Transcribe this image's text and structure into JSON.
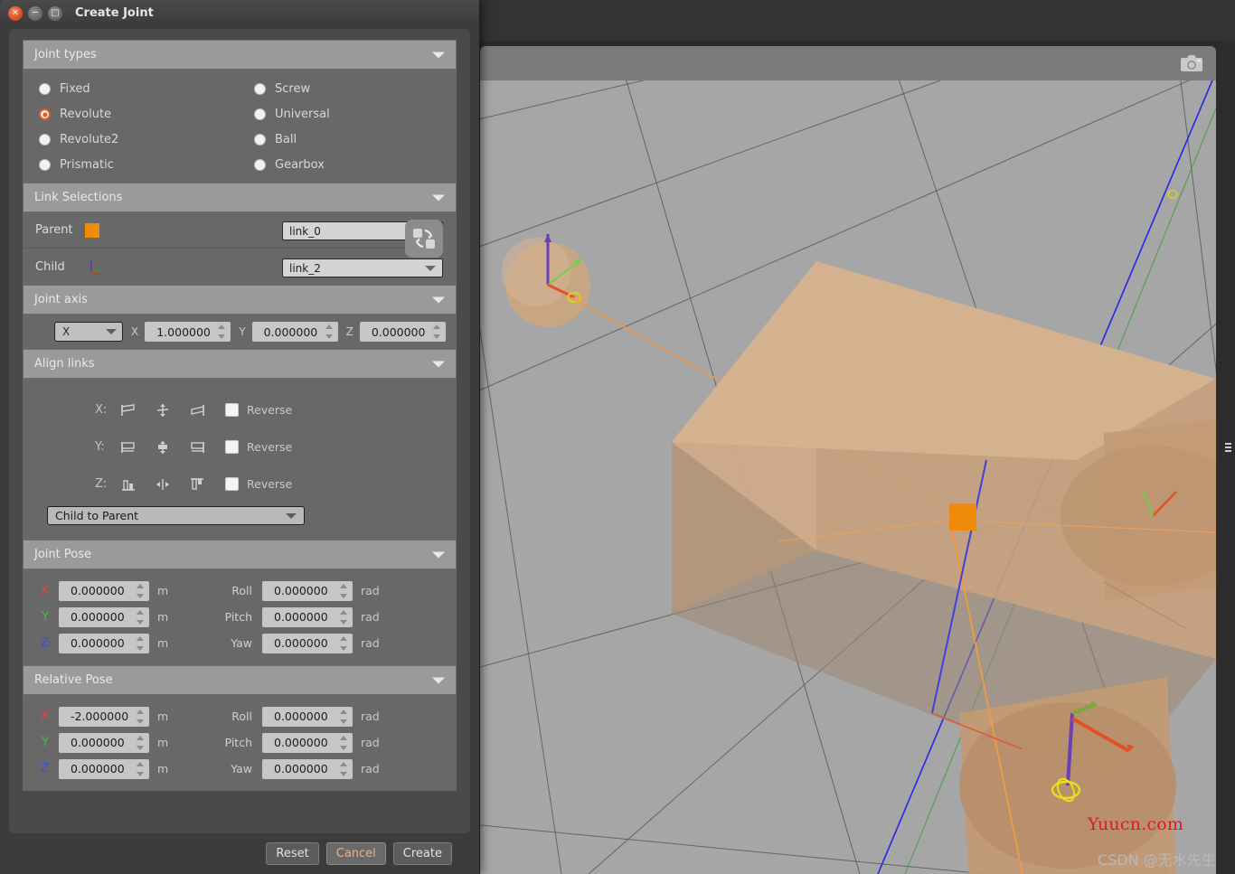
{
  "window": {
    "title": "Create Joint",
    "buttons": {
      "close": "close-button",
      "minimize": "minimize-button",
      "maximize": "maximize-button"
    }
  },
  "groups": {
    "joint_types": {
      "header": "Joint types",
      "options": [
        {
          "label": "Fixed",
          "selected": false
        },
        {
          "label": "Screw",
          "selected": false
        },
        {
          "label": "Revolute",
          "selected": true
        },
        {
          "label": "Universal",
          "selected": false
        },
        {
          "label": "Revolute2",
          "selected": false
        },
        {
          "label": "Ball",
          "selected": false
        },
        {
          "label": "Prismatic",
          "selected": false
        },
        {
          "label": "Gearbox",
          "selected": false
        }
      ]
    },
    "link_selections": {
      "header": "Link Selections",
      "parent_label": "Parent",
      "parent_value": "link_0",
      "child_label": "Child",
      "child_value": "link_2",
      "swap_button": "swap-links-button"
    },
    "joint_axis": {
      "header": "Joint axis",
      "preset": "X",
      "x_label": "X",
      "x_value": "1.000000",
      "y_label": "Y",
      "y_value": "0.000000",
      "z_label": "Z",
      "z_value": "0.000000"
    },
    "align_links": {
      "header": "Align links",
      "rows": [
        {
          "axis": "X:",
          "reverse_label": "Reverse",
          "reverse_checked": false
        },
        {
          "axis": "Y:",
          "reverse_label": "Reverse",
          "reverse_checked": false
        },
        {
          "axis": "Z:",
          "reverse_label": "Reverse",
          "reverse_checked": false
        }
      ],
      "mode": "Child to Parent"
    },
    "joint_pose": {
      "header": "Joint Pose",
      "rows": [
        {
          "axis": "X",
          "value": "0.000000",
          "unit": "m",
          "rot_label": "Roll",
          "rot_value": "0.000000",
          "rot_unit": "rad"
        },
        {
          "axis": "Y",
          "value": "0.000000",
          "unit": "m",
          "rot_label": "Pitch",
          "rot_value": "0.000000",
          "rot_unit": "rad"
        },
        {
          "axis": "Z",
          "value": "0.000000",
          "unit": "m",
          "rot_label": "Yaw",
          "rot_value": "0.000000",
          "rot_unit": "rad"
        }
      ]
    },
    "relative_pose": {
      "header": "Relative Pose",
      "rows": [
        {
          "axis": "X",
          "value": "-2.000000",
          "unit": "m",
          "rot_label": "Roll",
          "rot_value": "0.000000",
          "rot_unit": "rad"
        },
        {
          "axis": "Y",
          "value": "0.000000",
          "unit": "m",
          "rot_label": "Pitch",
          "rot_value": "0.000000",
          "rot_unit": "rad"
        },
        {
          "axis": "Z",
          "value": "0.000000",
          "unit": "m",
          "rot_label": "Yaw",
          "rot_value": "0.000000",
          "rot_unit": "rad"
        }
      ]
    }
  },
  "footer": {
    "reset": "Reset",
    "cancel": "Cancel",
    "create": "Create"
  },
  "viewport": {
    "camera_icon": "camera-icon",
    "splitter": "viewport-splitter"
  },
  "watermarks": {
    "site": "Yuucn.com",
    "author": "CSDN @无水先生"
  },
  "colors": {
    "accent": "#df5c21",
    "parent_swatch": "#f08a0a",
    "axis_x": "#e04545",
    "axis_y": "#3fbf3f",
    "axis_z": "#3a50e0",
    "panel_bg": "#4a4a4a",
    "group_bg": "#686868",
    "header_bg": "#9a9a9a",
    "viewport_bg": "#a6a6a6",
    "mesh_fill": "#c8a684"
  }
}
